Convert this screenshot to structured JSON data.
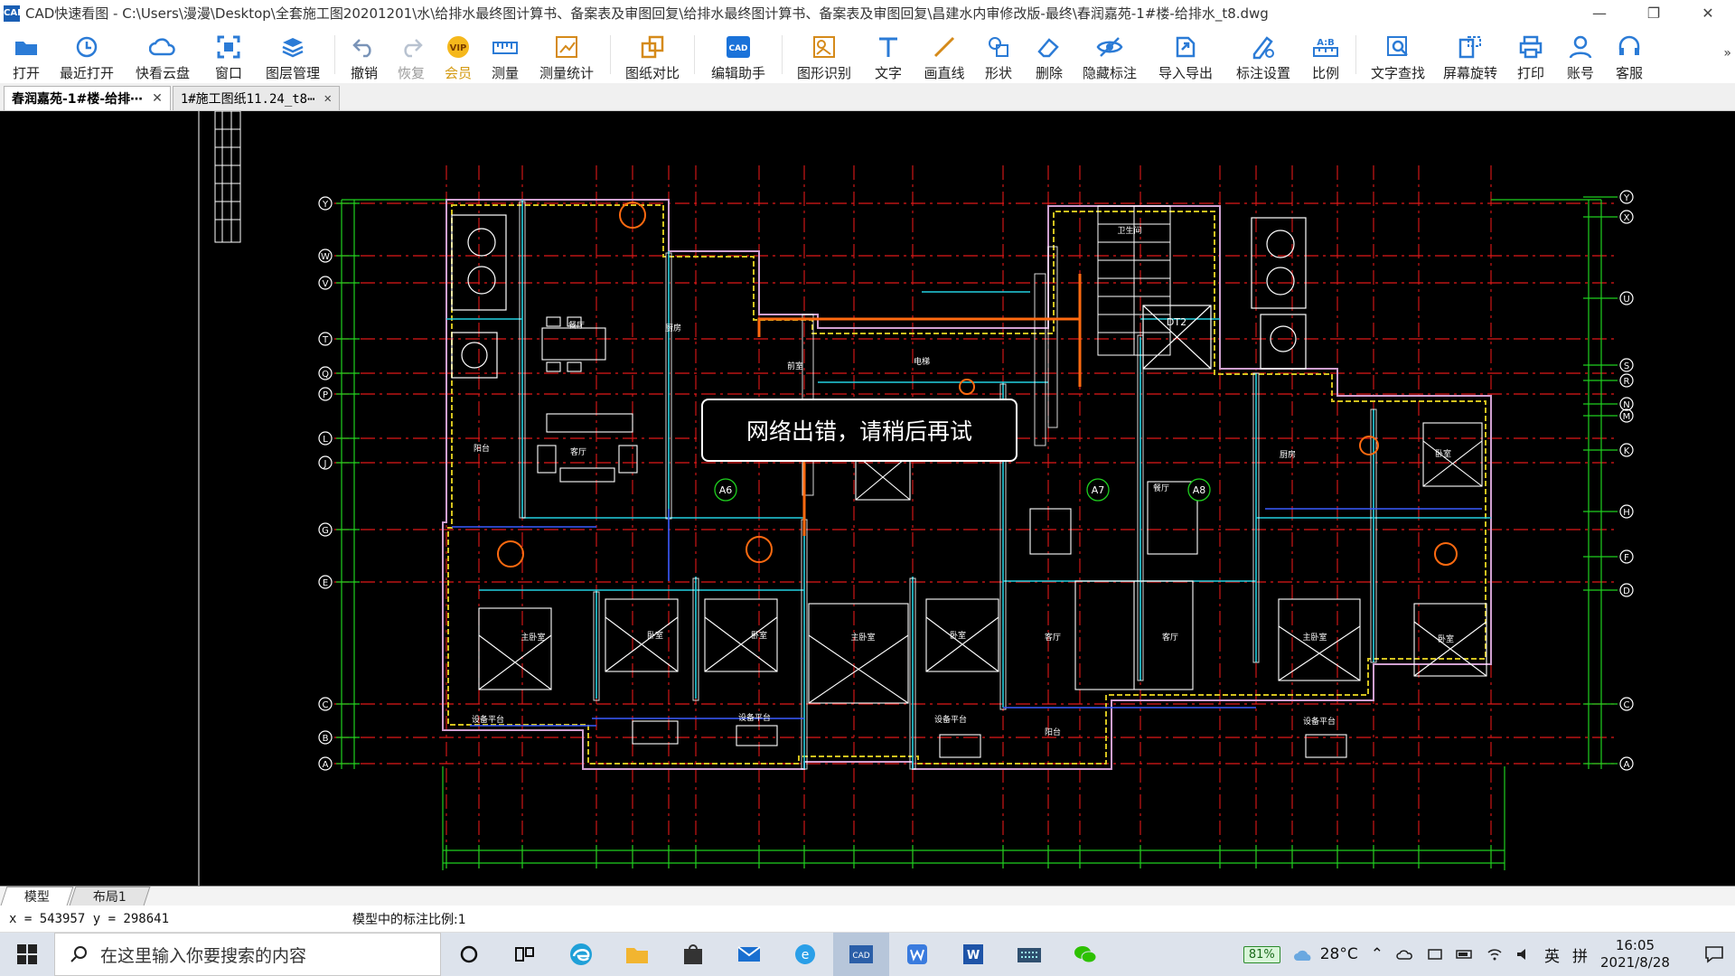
{
  "window": {
    "title": "CAD快速看图 - C:\\Users\\漫漫\\Desktop\\全套施工图20201201\\水\\给排水最终图计算书、备案表及审图回复\\给排水最终图计算书、备案表及审图回复\\昌建水内审修改版-最终\\春润嘉苑-1#楼-给排水_t8.dwg",
    "minimize": "—",
    "maximize": "❐",
    "close": "✕"
  },
  "toolbar": {
    "items": [
      {
        "label": "打开",
        "icon": "folder-open-icon"
      },
      {
        "label": "最近打开",
        "icon": "recent-clock-icon"
      },
      {
        "label": "快看云盘",
        "icon": "cloud-icon"
      },
      {
        "label": "窗口",
        "icon": "window-frame-icon"
      },
      {
        "label": "图层管理",
        "icon": "layers-icon"
      },
      {
        "label": "撤销",
        "icon": "undo-icon"
      },
      {
        "label": "恢复",
        "icon": "redo-icon"
      },
      {
        "label": "会员",
        "icon": "vip-badge-icon",
        "badge": "VIP"
      },
      {
        "label": "测量",
        "icon": "ruler-icon"
      },
      {
        "label": "测量统计",
        "icon": "measure-stats-icon"
      },
      {
        "label": "图纸对比",
        "icon": "compare-icon"
      },
      {
        "label": "编辑助手",
        "icon": "edit-assistant-icon",
        "badge": "CAD"
      },
      {
        "label": "图形识别",
        "icon": "shape-recognition-icon"
      },
      {
        "label": "文字",
        "icon": "text-t-icon"
      },
      {
        "label": "画直线",
        "icon": "line-icon"
      },
      {
        "label": "形状",
        "icon": "shapes-icon"
      },
      {
        "label": "删除",
        "icon": "eraser-icon"
      },
      {
        "label": "隐藏标注",
        "icon": "eye-hide-icon"
      },
      {
        "label": "导入导出",
        "icon": "import-export-icon"
      },
      {
        "label": "标注设置",
        "icon": "annotation-settings-icon"
      },
      {
        "label": "比例",
        "icon": "scale-ab-icon",
        "badge": "A:B"
      },
      {
        "label": "文字查找",
        "icon": "text-search-icon"
      },
      {
        "label": "屏幕旋转",
        "icon": "screen-rotate-icon"
      },
      {
        "label": "打印",
        "icon": "printer-icon"
      },
      {
        "label": "账号",
        "icon": "user-icon"
      },
      {
        "label": "客服",
        "icon": "headset-icon"
      }
    ],
    "overflow": "»"
  },
  "tabs": [
    {
      "label": "春润嘉苑-1#楼-给排⋯",
      "close": "✕",
      "active": true
    },
    {
      "label": "1#施工图纸11.24_t8⋯",
      "close": "✕",
      "active": false
    }
  ],
  "canvas": {
    "toast": "网络出错，请稍后再试",
    "grid_left_labels": [
      "Y",
      "W",
      "V",
      "T",
      "Q",
      "P",
      "L",
      "J",
      "G",
      "E",
      "C",
      "B",
      "A"
    ],
    "grid_right_labels": [
      "Y",
      "X",
      "U",
      "S",
      "R",
      "N",
      "M",
      "K",
      "H",
      "F",
      "D",
      "C",
      "A"
    ],
    "unit_labels": [
      "A6",
      "A7",
      "A8"
    ],
    "room_labels": [
      "客厅",
      "餐厅",
      "主卧室",
      "卧室",
      "卧室",
      "主卧室",
      "卧室",
      "客厅",
      "客厅",
      "主卧室",
      "卧室",
      "阳台",
      "阳台",
      "厨房",
      "厨房",
      "设备平台",
      "设备平台",
      "设备平台",
      "设备平台",
      "前室",
      "电梯",
      "卫生间",
      "餐厅",
      "卧室"
    ],
    "elevator_label": "DT2"
  },
  "layout_tabs": [
    {
      "label": "模型",
      "active": true
    },
    {
      "label": "布局1",
      "active": false
    }
  ],
  "status": {
    "coords": "x = 543957  y = 298641",
    "scale_text": "模型中的标注比例:1"
  },
  "taskbar": {
    "search_placeholder": "在这里输入你要搜索的内容",
    "apps": [
      "cortana-circle-icon",
      "task-view-icon",
      "edge-icon",
      "file-explorer-icon",
      "store-icon",
      "mail-icon",
      "ie-browser-icon",
      "cad-viewer-icon",
      "wps-writer-icon",
      "word-icon",
      "keyboard-app-icon",
      "wechat-icon"
    ],
    "battery": "81%",
    "weather": "28°C",
    "ime_lang": "英",
    "ime_mode": "拼",
    "time": "16:05",
    "date": "2021/8/28"
  }
}
